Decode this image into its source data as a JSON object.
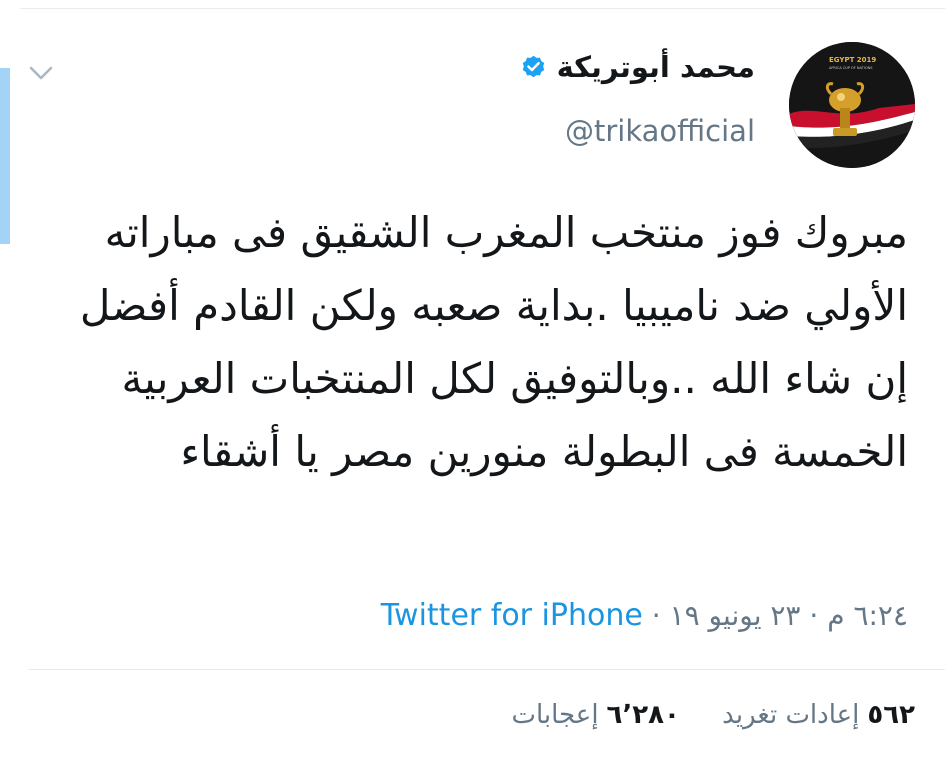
{
  "author": {
    "display_name": "محمد أبوتريكة",
    "handle": "@trikaofficial",
    "verified": true,
    "verified_icon": "verified-badge-icon",
    "avatar_text": "EGYPT 2019",
    "avatar_subtext": "AFRICA CUP OF NATIONS"
  },
  "tweet": {
    "text": "مبروك فوز منتخب المغرب الشقيق فى مباراته الأولي ضد ناميبيا .بداية صعبه ولكن القادم أفضل إن شاء الله ..وبالتوفيق لكل المنتخبات العربية الخمسة فى البطولة منورين مصر يا أشقاء",
    "time": "٦:٢٤ م",
    "separator": "·",
    "date": "٢٣ يونيو ١٩",
    "source": "Twitter for iPhone"
  },
  "stats": {
    "retweets_count": "٥٦٢",
    "retweets_label": "إعادات تغريد",
    "likes_count": "٦٬٢٨٠",
    "likes_label": "إعجابات"
  },
  "icons": {
    "caret": "chevron-down-icon"
  },
  "colors": {
    "text": "#14171a",
    "secondary": "#657786",
    "link": "#1b95e0",
    "verified": "#1da1f2",
    "accent_bar": "#a3d3f5",
    "divider": "#e6ecf0"
  }
}
